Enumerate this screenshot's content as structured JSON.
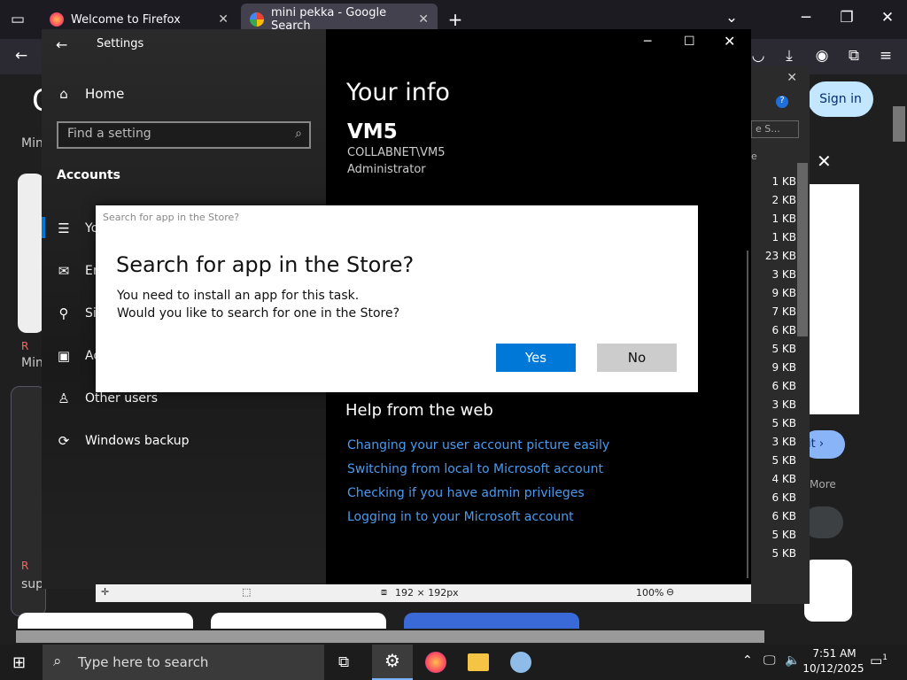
{
  "firefox": {
    "tabs": [
      {
        "title": "Welcome to Firefox"
      },
      {
        "title": "mini pekka - Google Search"
      }
    ],
    "new_tab": "+",
    "sign_in": "Sign in",
    "more_label": "More",
    "page_fragments": [
      "Min",
      "Min",
      "sup",
      "R",
      "R",
      "R",
      "it"
    ]
  },
  "settings": {
    "title": "Settings",
    "home": "Home",
    "search_placeholder": "Find a setting",
    "section": "Accounts",
    "nav": [
      {
        "label": "Yo"
      },
      {
        "label": "Em"
      },
      {
        "label": "Si"
      },
      {
        "label": "Ac"
      },
      {
        "label": "Other users"
      },
      {
        "label": "Windows backup"
      }
    ],
    "heading": "Your info",
    "user_name": "VM5",
    "domain_user": "COLLABNET\\VM5",
    "role": "Administrator",
    "help_heading": "Help from the web",
    "help_links": [
      "Changing your user account picture easily",
      "Switching from local to Microsoft account",
      "Checking if you have admin privileges",
      "Logging in to your Microsoft account"
    ]
  },
  "dialog": {
    "caption": "Search for app in the Store?",
    "title": "Search for app in the Store?",
    "line1": "You need to install an app for this task.",
    "line2": "Would you like to search for one in the Store?",
    "yes": "Yes",
    "no": "No"
  },
  "file_panel": {
    "search_text": "e S...",
    "col_header": "e",
    "sizes": [
      "1 KB",
      "2 KB",
      "1 KB",
      "1 KB",
      "23 KB",
      "3 KB",
      "9 KB",
      "7 KB",
      "6 KB",
      "5 KB",
      "9 KB",
      "6 KB",
      "3 KB",
      "5 KB",
      "3 KB",
      "5 KB",
      "4 KB",
      "6 KB",
      "6 KB",
      "5 KB",
      "5 KB"
    ]
  },
  "status_bar": {
    "dimensions": "192 × 192px",
    "zoom": "100%"
  },
  "taskbar": {
    "search_placeholder": "Type here to search",
    "time": "7:51 AM",
    "date": "10/12/2025",
    "notifications": "1"
  },
  "colors": {
    "accent": "#0078d7",
    "link": "#4a9bf0",
    "firefox_bg": "#1c1b22"
  }
}
